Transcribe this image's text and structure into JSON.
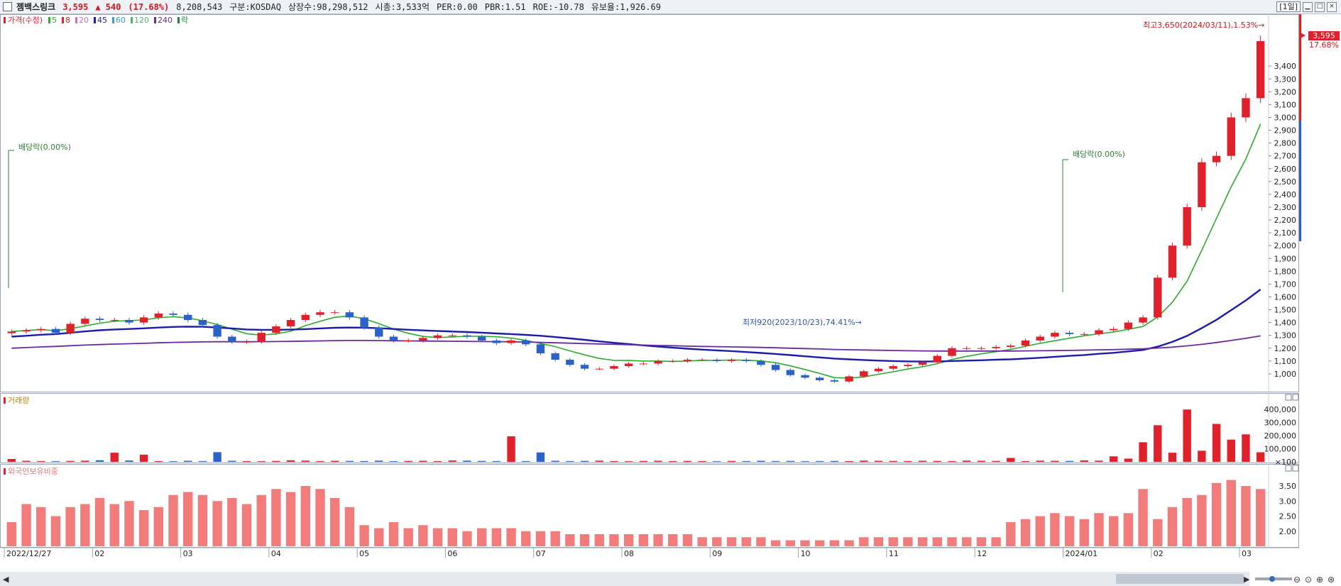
{
  "header": {
    "name": "젬백스링크",
    "price": "3,595",
    "change": "▲ 540",
    "change_pct": "(17.68%)",
    "volume": "8,208,543",
    "market": "구분:KOSDAQ",
    "listed": "상장수:98,298,512",
    "mcap": "시총:3,533억",
    "per": "PER:0.00",
    "pbr": "PBR:1.51",
    "roe": "ROE:-10.78",
    "float": "유보율:1,926.69",
    "period": "[1일]"
  },
  "legend": {
    "price_label": "가격(수정)",
    "ma_labels": [
      "5",
      "8",
      "20",
      "45",
      "60",
      "120",
      "240",
      "락"
    ],
    "ma_colors": [
      "#2eaa2e",
      "#e0202a",
      "#c86ed0",
      "#1c1ca8",
      "#3aa0b8",
      "#58b070",
      "#6a2a9a",
      "#1a8a3a"
    ]
  },
  "colors": {
    "up": "#e0202a",
    "down": "#2a62c8",
    "foreign": "#f27c7c",
    "annot": "#2e7d32",
    "accent": "#d4141c"
  },
  "annotations": {
    "high": "최고3,650(2024/03/11),1.53%→",
    "low": "최저920(2023/10/23),74.41%→",
    "div1": "배당락(0.00%)",
    "div2": "배당락(0.00%)",
    "last_price_tag": "3,595",
    "last_pct_tag": "17.68%"
  },
  "volume_panel": {
    "title": "거래량"
  },
  "foreign_panel": {
    "title": "외국인보유비중"
  },
  "x_axis": [
    "2022/12/27",
    "02",
    "03",
    "04",
    "05",
    "06",
    "07",
    "08",
    "09",
    "10",
    "11",
    "12",
    "2024/01",
    "02",
    "03"
  ],
  "chart_data": [
    {
      "type": "candlestick",
      "title": "가격(수정)",
      "ylim": [
        900,
        3650
      ],
      "yticks": [
        1000,
        1100,
        1200,
        1300,
        1400,
        1500,
        1600,
        1700,
        1800,
        1900,
        2000,
        2100,
        2200,
        2300,
        2400,
        2500,
        2600,
        2700,
        2800,
        2900,
        3000,
        3100,
        3200,
        3300,
        3400
      ],
      "x": [
        "2022/12/27",
        "02",
        "03",
        "04",
        "05",
        "06",
        "07",
        "08",
        "09",
        "10",
        "11",
        "12",
        "2024/01",
        "02",
        "03"
      ],
      "close": [
        1330,
        1340,
        1350,
        1320,
        1390,
        1430,
        1420,
        1420,
        1400,
        1440,
        1470,
        1460,
        1420,
        1380,
        1290,
        1250,
        1250,
        1320,
        1370,
        1420,
        1460,
        1480,
        1480,
        1440,
        1360,
        1290,
        1260,
        1260,
        1280,
        1300,
        1300,
        1290,
        1260,
        1240,
        1260,
        1230,
        1160,
        1110,
        1070,
        1040,
        1040,
        1060,
        1080,
        1080,
        1100,
        1100,
        1110,
        1110,
        1100,
        1110,
        1100,
        1070,
        1030,
        990,
        970,
        950,
        940,
        980,
        1020,
        1040,
        1060,
        1070,
        1090,
        1140,
        1200,
        1200,
        1200,
        1210,
        1220,
        1260,
        1290,
        1320,
        1310,
        1310,
        1340,
        1350,
        1400,
        1440,
        1750,
        2000,
        2300,
        2650,
        2700,
        3000,
        3150,
        3595
      ],
      "ma": [
        {
          "name": "5",
          "values": [
            1330,
            1338,
            1345,
            1336,
            1352,
            1373,
            1395,
            1410,
            1415,
            1420,
            1438,
            1445,
            1436,
            1414,
            1384,
            1348,
            1313,
            1302,
            1311,
            1332,
            1376,
            1410,
            1441,
            1450,
            1430,
            1391,
            1349,
            1316,
            1292,
            1283,
            1288,
            1293,
            1293,
            1289,
            1279,
            1261,
            1237,
            1212,
            1179,
            1148,
            1120,
            1105,
            1104,
            1100,
            1100,
            1097,
            1100,
            1106,
            1105,
            1108,
            1106,
            1101,
            1087,
            1062,
            1034,
            1003,
            970,
            967,
            976,
            997,
            1016,
            1038,
            1055,
            1079,
            1112,
            1136,
            1156,
            1173,
            1190,
            1215,
            1238,
            1258,
            1278,
            1297,
            1313,
            1326,
            1347,
            1369,
            1444,
            1558,
            1723,
            1964,
            2213,
            2458,
            2676,
            2949
          ]
        },
        {
          "name": "45",
          "values": [
            1290,
            1297,
            1305,
            1310,
            1320,
            1331,
            1340,
            1346,
            1350,
            1355,
            1361,
            1366,
            1368,
            1367,
            1361,
            1354,
            1346,
            1343,
            1343,
            1345,
            1349,
            1354,
            1359,
            1361,
            1360,
            1356,
            1350,
            1344,
            1339,
            1334,
            1330,
            1326,
            1321,
            1315,
            1310,
            1304,
            1297,
            1287,
            1276,
            1265,
            1253,
            1242,
            1232,
            1222,
            1212,
            1204,
            1196,
            1189,
            1183,
            1177,
            1170,
            1163,
            1155,
            1146,
            1137,
            1128,
            1119,
            1113,
            1108,
            1103,
            1100,
            1097,
            1096,
            1097,
            1100,
            1103,
            1106,
            1110,
            1113,
            1119,
            1125,
            1133,
            1140,
            1147,
            1156,
            1164,
            1175,
            1186,
            1212,
            1249,
            1296,
            1357,
            1421,
            1497,
            1573,
            1658
          ]
        },
        {
          "name": "240",
          "values": [
            1200,
            1205,
            1210,
            1214,
            1219,
            1224,
            1228,
            1232,
            1235,
            1238,
            1242,
            1245,
            1247,
            1249,
            1250,
            1250,
            1250,
            1251,
            1252,
            1253,
            1255,
            1257,
            1259,
            1260,
            1260,
            1259,
            1258,
            1257,
            1256,
            1255,
            1254,
            1253,
            1252,
            1251,
            1250,
            1248,
            1245,
            1242,
            1239,
            1236,
            1233,
            1230,
            1227,
            1224,
            1221,
            1219,
            1216,
            1214,
            1212,
            1210,
            1208,
            1206,
            1203,
            1200,
            1197,
            1194,
            1190,
            1188,
            1186,
            1184,
            1182,
            1180,
            1179,
            1178,
            1178,
            1178,
            1178,
            1178,
            1178,
            1179,
            1180,
            1181,
            1183,
            1185,
            1187,
            1189,
            1192,
            1195,
            1201,
            1208,
            1218,
            1230,
            1244,
            1260,
            1277,
            1296
          ]
        }
      ]
    },
    {
      "type": "bar",
      "title": "거래량",
      "ylim": [
        0,
        450000
      ],
      "yticks": [
        100,
        100000,
        200000,
        300000,
        400000
      ],
      "values": [
        22000,
        8000,
        6000,
        5000,
        7000,
        9000,
        12000,
        70000,
        10000,
        55000,
        6000,
        5000,
        8000,
        6000,
        74000,
        8000,
        6000,
        5000,
        7000,
        12000,
        9000,
        6000,
        8000,
        7000,
        6000,
        9000,
        5000,
        7000,
        8000,
        6000,
        10000,
        9000,
        7000,
        6000,
        195000,
        6000,
        72000,
        8000,
        6000,
        7000,
        9000,
        6000,
        5000,
        7000,
        8000,
        6000,
        7000,
        6000,
        5000,
        7000,
        6000,
        8000,
        6000,
        7000,
        5000,
        6000,
        7000,
        6000,
        9000,
        8000,
        7000,
        6000,
        8000,
        7000,
        6000,
        9000,
        8000,
        7000,
        30000,
        6000,
        9000,
        8000,
        7000,
        11000,
        9000,
        42000,
        25000,
        150000,
        280000,
        70000,
        400000,
        85000,
        290000,
        170000,
        210000,
        73000
      ]
    },
    {
      "type": "bar",
      "title": "외국인보유비중",
      "ylim": [
        1.5,
        3.9
      ],
      "yticks": [
        2.0,
        2.5,
        3.0,
        3.5
      ],
      "values": [
        2.3,
        2.9,
        2.8,
        2.5,
        2.8,
        2.9,
        3.1,
        2.9,
        3.0,
        2.7,
        2.8,
        3.2,
        3.3,
        3.2,
        3.0,
        3.1,
        2.9,
        3.2,
        3.4,
        3.3,
        3.5,
        3.4,
        3.1,
        2.8,
        2.2,
        2.1,
        2.3,
        2.1,
        2.2,
        2.1,
        2.1,
        2.0,
        2.1,
        2.1,
        2.1,
        2.0,
        2.0,
        2.0,
        1.9,
        1.9,
        1.9,
        1.9,
        1.9,
        1.9,
        1.9,
        1.9,
        1.9,
        1.8,
        1.8,
        1.8,
        1.8,
        1.8,
        1.7,
        1.7,
        1.7,
        1.7,
        1.7,
        1.7,
        1.8,
        1.8,
        1.8,
        1.8,
        1.8,
        1.8,
        1.8,
        1.8,
        1.8,
        1.8,
        2.3,
        2.4,
        2.5,
        2.6,
        2.5,
        2.4,
        2.6,
        2.5,
        2.6,
        3.4,
        2.4,
        2.8,
        3.1,
        3.2,
        3.6,
        3.7,
        3.5,
        3.4
      ]
    }
  ]
}
